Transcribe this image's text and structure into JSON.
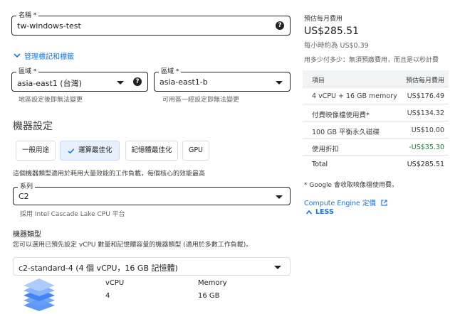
{
  "name_field": {
    "label": "名稱 *",
    "value": "tw-windows-test"
  },
  "manage_tags_link": "管理標記和標籤",
  "region_field": {
    "label": "區域 *",
    "value": "asia-east1 (台灣)",
    "hint": "地區設定後即無法變更"
  },
  "zone_field": {
    "label": "區域 *",
    "value": "asia-east1-b",
    "hint": "可用區一經設定即無法變更"
  },
  "machine_config": {
    "title": "機器設定",
    "tabs": [
      "一般用途",
      "運算最佳化",
      "記憶體最佳化",
      "GPU"
    ],
    "active_tab": "運算最佳化",
    "description": "這個機器類型適用於耗用大量效能的工作負載，每個核心的效能最高",
    "series_field": {
      "label": "系列",
      "value": "C2",
      "hint": "採用 Intel Cascade Lake CPU 平台"
    },
    "machine_type_title": "機器類型",
    "machine_type_desc": "您可以選用已預先設定 vCPU 數量和記憶體容量的機器類型 (適用於多數工作負載)。",
    "machine_type_value": "c2-standard-4 (4 個 vCPU，16 GB 記憶體)",
    "specs": {
      "vcpu_label": "vCPU",
      "vcpu_value": "4",
      "memory_label": "Memory",
      "memory_value": "16 GB"
    }
  },
  "pricing": {
    "monthly_label": "預估每月費用",
    "monthly_total": "US$285.51",
    "hourly": "每小時約為 US$0.39",
    "note": "用多少付多少：無須預繳費用，而且是以秒計費",
    "table_header": {
      "item": "項目",
      "cost": "預估每月費用"
    },
    "rows": [
      {
        "item": "4 vCPU + 16 GB memory",
        "cost": "US$176.49"
      },
      {
        "item": "付費映像檔使用費*",
        "cost": "US$134.32"
      },
      {
        "item": "100 GB 平衡永久磁碟",
        "cost": "US$10.00"
      },
      {
        "item": "使用折扣",
        "cost": "-US$35.30"
      },
      {
        "item": "Total",
        "cost": "US$285.51"
      }
    ],
    "footnote": "* Google 會收取映像檔使用費。",
    "compute_engine_link": "Compute Engine 定價",
    "less_link": "LESS"
  },
  "colors": {
    "accent": "#1a73e8",
    "discount": "#188038",
    "active_tab_bg": "#e8f0fe"
  }
}
